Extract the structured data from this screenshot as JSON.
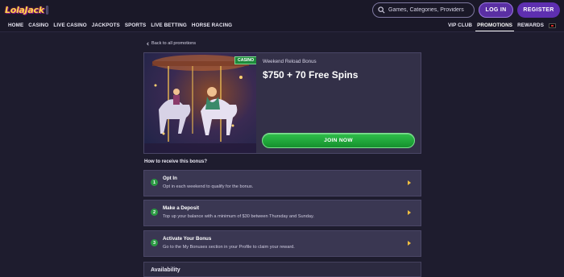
{
  "brand": {
    "logo_text": "LolaJack"
  },
  "search": {
    "placeholder": "Games, Categories, Providers"
  },
  "auth": {
    "login_label": "LOG IN",
    "register_label": "REGISTER"
  },
  "nav": {
    "left": [
      "HOME",
      "CASINO",
      "LIVE CASINO",
      "JACKPOTS",
      "SPORTS",
      "LIVE BETTING",
      "HORSE RACING"
    ],
    "right": [
      "VIP CLUB",
      "PROMOTIONS",
      "REWARDS"
    ],
    "active": "PROMOTIONS"
  },
  "promo": {
    "back_label": "Back to all promotions",
    "badge": "CASINO",
    "subtitle": "Weekend Reload Bonus",
    "title": "$750 + 70 Free Spins",
    "cta_label": "JOIN NOW"
  },
  "how": {
    "title": "How to receive this bonus?",
    "steps": [
      {
        "num": "1",
        "title": "Opt In",
        "desc": "Opt in each weekend to qualify for the bonus."
      },
      {
        "num": "2",
        "title": "Make a Deposit",
        "desc": "Top up your balance with a minimum of $30 between Thursday and Sunday."
      },
      {
        "num": "3",
        "title": "Activate Your Bonus",
        "desc": "Go to the My Bonuses section in your Profile to claim your reward."
      }
    ]
  },
  "availability": {
    "title": "Availability"
  },
  "colors": {
    "background": "#1e1c2e",
    "accent_purple": "#5e2fb0",
    "cta_green": "#2fbf4b",
    "logo_yellow": "#ffd84a"
  },
  "icons": [
    "search-icon",
    "back-chevron-icon",
    "chevron-right-icon",
    "flag-icon"
  ]
}
